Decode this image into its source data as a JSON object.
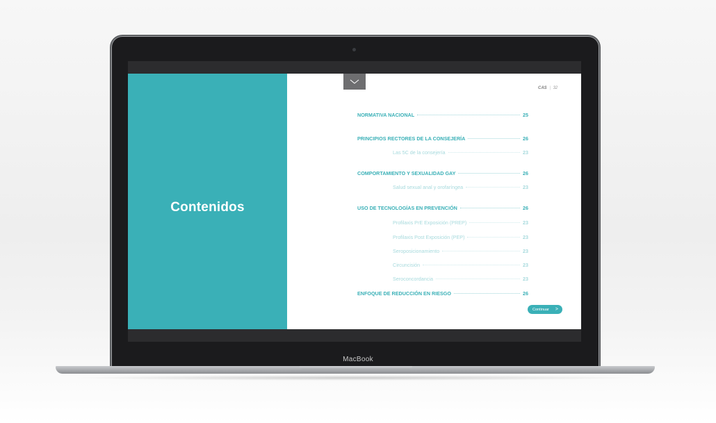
{
  "device": {
    "brand_label": "MacBook"
  },
  "app": {
    "left_title": "Contenidos",
    "page_indicator": {
      "lang": "CAS",
      "separator": "|",
      "page": "32"
    },
    "menu_toggle_icon": "chevron-down-icon",
    "toc": [
      {
        "label": "NORMATIVA NACIONAL",
        "page": "25",
        "level": "main"
      },
      {
        "label": "PRINCIPIOS RECTORES DE LA CONSEJERÍA",
        "page": "26",
        "level": "main"
      },
      {
        "label": "Las 5C de la consejería",
        "page": "23",
        "level": "sub"
      },
      {
        "label": "COMPORTAMIENTO Y SEXUALIDAD GAY",
        "page": "26",
        "level": "main"
      },
      {
        "label": "Salud sexual anal y orofaríngea",
        "page": "23",
        "level": "sub"
      },
      {
        "label": "USO DE TECNOLOGÍAS EN PREVENCIÓN",
        "page": "26",
        "level": "main"
      },
      {
        "label": "Profilaxis PrE Exposición (PREP)",
        "page": "23",
        "level": "sub"
      },
      {
        "label": "Profilaxis Post Exposición (PEP)",
        "page": "23",
        "level": "sub"
      },
      {
        "label": "Seroposicionamiento",
        "page": "23",
        "level": "sub"
      },
      {
        "label": "Circuncisión",
        "page": "23",
        "level": "sub"
      },
      {
        "label": "Seroconcordancia",
        "page": "23",
        "level": "sub"
      },
      {
        "label": "ENFOQUE DE REDUCCIÓN EN RIESGO",
        "page": "26",
        "level": "main"
      }
    ],
    "continue_button": {
      "label": "Continuar",
      "icon": "chevron-right-icon"
    }
  },
  "colors": {
    "accent": "#3ab0b7",
    "accent_light": "#a7dadd",
    "menu_toggle": "#6e6e70"
  }
}
